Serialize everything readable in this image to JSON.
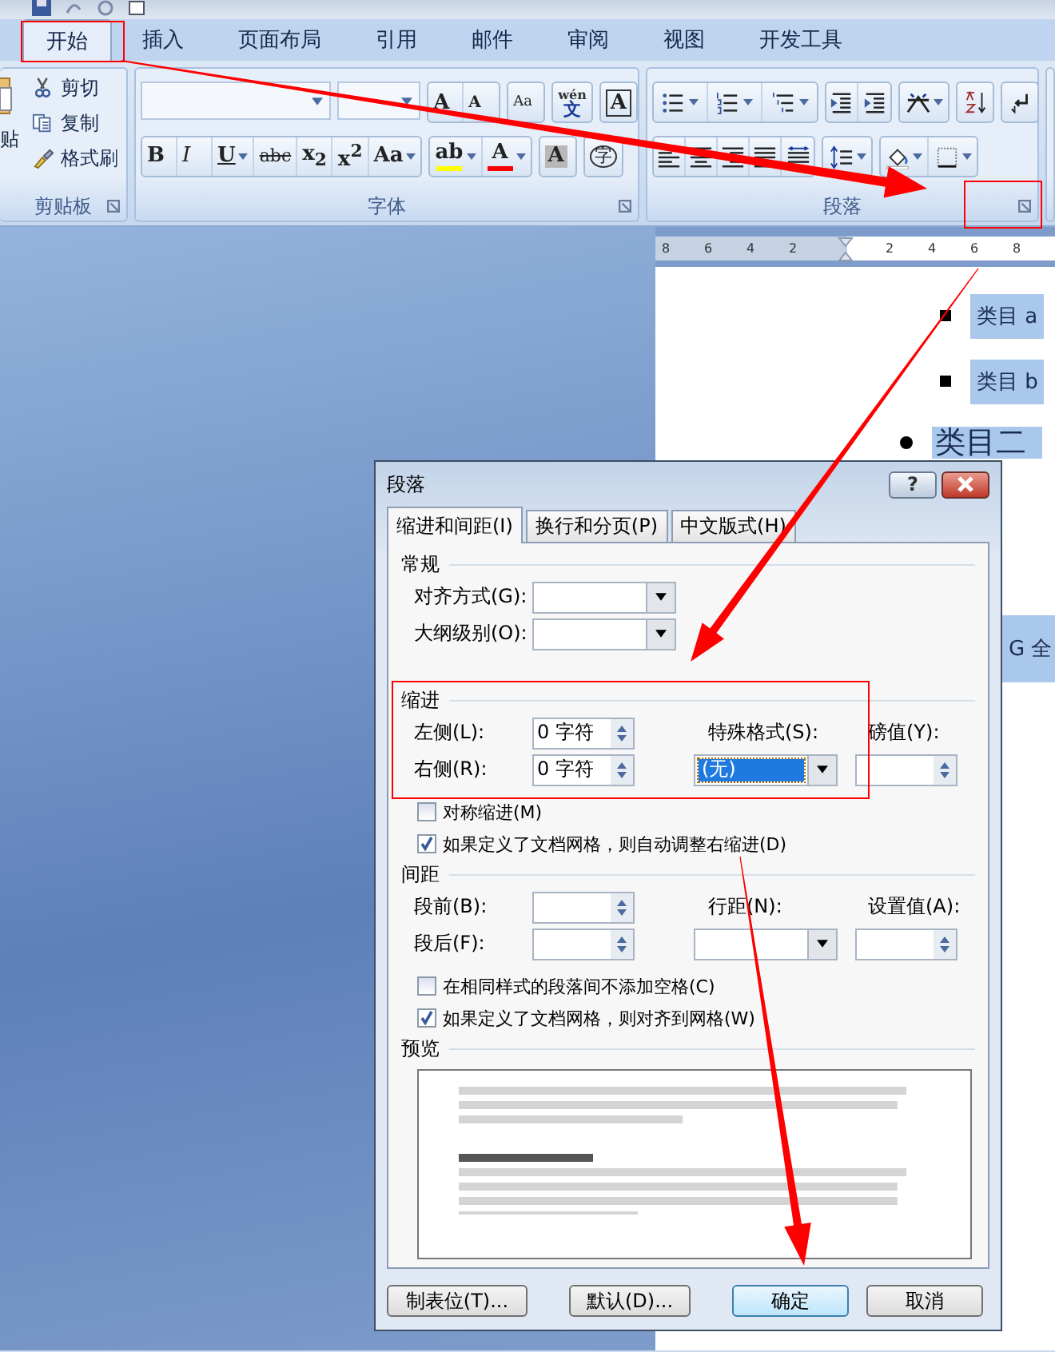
{
  "ribbon_tabs": [
    {
      "label": "开始",
      "selected": true
    },
    {
      "label": "插入",
      "selected": false
    },
    {
      "label": "页面布局",
      "selected": false
    },
    {
      "label": "引用",
      "selected": false
    },
    {
      "label": "邮件",
      "selected": false
    },
    {
      "label": "审阅",
      "selected": false
    },
    {
      "label": "视图",
      "selected": false
    },
    {
      "label": "开发工具",
      "selected": false
    }
  ],
  "clipboard": {
    "title": "剪贴板",
    "paste_label": "贴",
    "items": [
      {
        "label": "剪切",
        "kind": "cut"
      },
      {
        "label": "复制",
        "kind": "copy"
      },
      {
        "label": "格式刷",
        "kind": "brush"
      }
    ]
  },
  "font": {
    "title": "字体",
    "row1": [
      {
        "glyph": "A",
        "kind": "grow",
        "dropdown": false
      },
      {
        "glyph": "A",
        "kind": "shrink",
        "dropdown": false
      },
      {
        "glyph": "Aa",
        "kind": "clear",
        "dropdown": false
      },
      {
        "glyph": "文",
        "ruby": "wén",
        "kind": "phonetic",
        "dropdown": false
      },
      {
        "glyph": "A",
        "kind": "border",
        "dropdown": false
      }
    ],
    "row2": [
      {
        "glyph": "B",
        "kind": "bold",
        "dropdown": false
      },
      {
        "glyph": "I",
        "kind": "italic",
        "dropdown": false
      },
      {
        "glyph": "U",
        "kind": "underline",
        "dropdown": true
      },
      {
        "glyph": "abc",
        "kind": "strike",
        "dropdown": false
      },
      {
        "glyph": "x$_{2}$",
        "kind": "sub",
        "dropdown": false
      },
      {
        "glyph": "x$^{2}$",
        "kind": "sup",
        "dropdown": false
      },
      {
        "glyph": "Aa",
        "kind": "case",
        "dropdown": true
      },
      {
        "glyph": "ab",
        "kind": "highlight",
        "dropdown": true,
        "color": "#ffff00"
      },
      {
        "glyph": "A",
        "kind": "fontcolor",
        "dropdown": true,
        "color": "#ff0000"
      },
      {
        "glyph": "A",
        "kind": "shade",
        "dropdown": false
      },
      {
        "glyph": "字",
        "kind": "enclose",
        "dropdown": false
      }
    ]
  },
  "paragraph": {
    "title": "段落"
  },
  "ruler": {
    "ticks": [
      "8",
      "6",
      "4",
      "2",
      "2",
      "4",
      "6",
      "8"
    ]
  },
  "document": {
    "items": [
      {
        "kind": "square",
        "text": "类目 a"
      },
      {
        "kind": "square",
        "text": "类目 b"
      },
      {
        "kind": "dot",
        "text": "类目二"
      },
      {
        "kind": "plain",
        "text": "G 全"
      }
    ]
  },
  "dialog": {
    "title": "段落",
    "help": "?",
    "tabs": [
      {
        "label": "缩进和间距(I)",
        "selected": true
      },
      {
        "label": "换行和分页(P)",
        "selected": false
      },
      {
        "label": "中文版式(H)",
        "selected": false
      }
    ],
    "general": {
      "heading": "常规",
      "rows": [
        {
          "label": "对齐方式(G):"
        },
        {
          "label": "大纲级别(O):"
        }
      ]
    },
    "indent": {
      "heading": "缩进",
      "left": {
        "label": "左侧(L):",
        "value": "0 字符"
      },
      "right": {
        "label": "右侧(R):",
        "value": "0 字符"
      },
      "special": {
        "label": "特殊格式(S):",
        "value": "(无)"
      },
      "by": {
        "label": "磅值(Y):"
      }
    },
    "indent_options": [
      {
        "label": "对称缩进(M)",
        "checked": false
      },
      {
        "label": "如果定义了文档网格，则自动调整右缩进(D)",
        "checked": true
      }
    ],
    "spacing": {
      "heading": "间距",
      "before": {
        "label": "段前(B):"
      },
      "after": {
        "label": "段后(F):"
      },
      "line": {
        "label": "行距(N):"
      },
      "at": {
        "label": "设置值(A):"
      }
    },
    "spacing_options": [
      {
        "label": "在相同样式的段落间不添加空格(C)",
        "checked": false
      },
      {
        "label": "如果定义了文档网格，则对齐到网格(W)",
        "checked": true
      }
    ],
    "preview": {
      "heading": "预览"
    },
    "buttons": [
      {
        "label": "制表位(T)...",
        "default": false
      },
      {
        "label": "默认(D)...",
        "default": false
      },
      {
        "label": "确定",
        "default": true
      },
      {
        "label": "取消",
        "default": false
      }
    ]
  }
}
